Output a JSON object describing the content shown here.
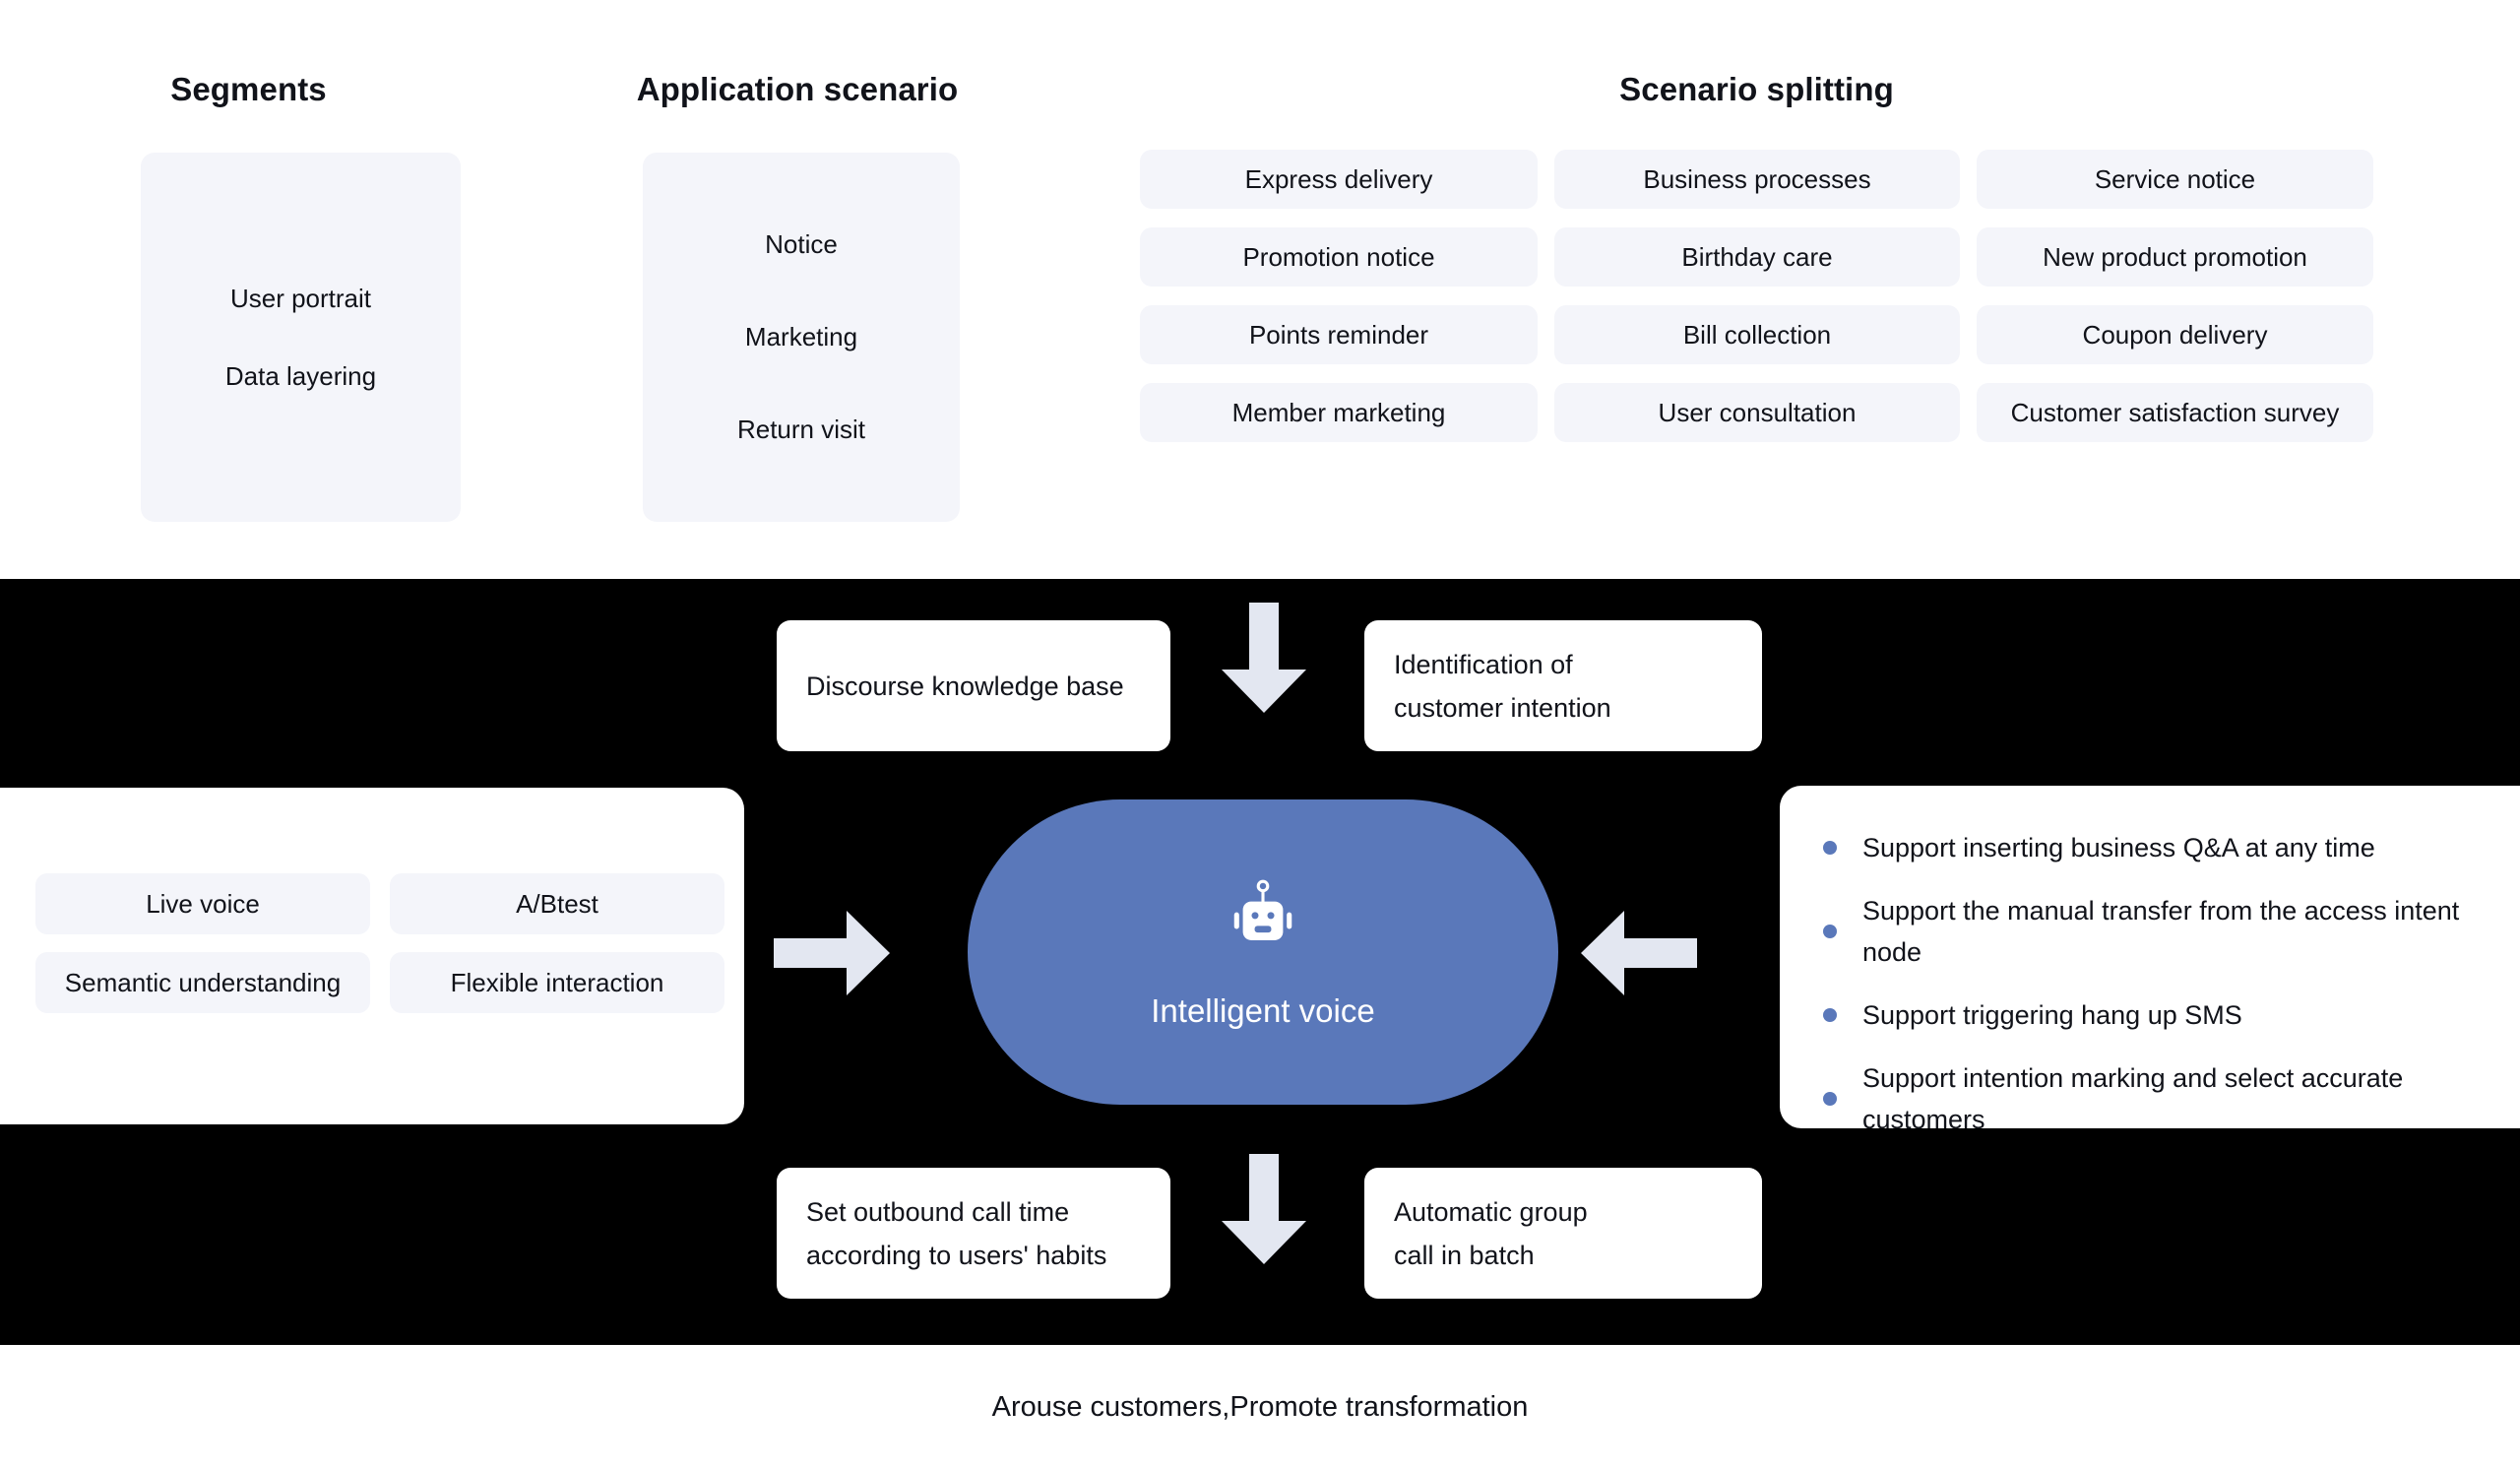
{
  "colors": {
    "chip_bg": "#f4f5fa",
    "accent_blue": "#5a78ba",
    "arrow_fill": "#e3e7f1",
    "black_panel": "#000000",
    "text": "#11131a"
  },
  "top": {
    "columns": [
      {
        "title": "Segments",
        "items": [
          "User portrait",
          "Data layering"
        ]
      },
      {
        "title": "Application scenario",
        "items": [
          "Notice",
          "Marketing",
          "Return visit"
        ]
      }
    ],
    "scenario_splitting": {
      "title": "Scenario splitting",
      "chips": [
        "Express delivery",
        "Business processes",
        "Service notice",
        "Promotion notice",
        "Birthday care",
        "New product promotion",
        "Points reminder",
        "Bill collection",
        "Coupon delivery",
        "Member marketing",
        "User consultation",
        "Customer satisfaction survey"
      ]
    }
  },
  "middle": {
    "center": {
      "label": "Intelligent voice",
      "icon": "robot-icon"
    },
    "top_cards": [
      {
        "text": "Discourse knowledge base"
      },
      {
        "text": "Identification of\ncustomer intention"
      }
    ],
    "bottom_cards": [
      {
        "text": "Set outbound call time\naccording to users' habits"
      },
      {
        "text": "Automatic group\ncall in batch"
      }
    ],
    "left_panel": {
      "chips": [
        "Live voice",
        "A/Btest",
        "Semantic understanding",
        "Flexible interaction"
      ]
    },
    "right_panel": {
      "bullets": [
        "Support inserting business Q&A at any time",
        "Support the manual transfer from the access intent node",
        "Support triggering hang up SMS",
        "Support intention marking and select accurate customers"
      ]
    },
    "arrows": [
      {
        "name": "arrow-down-top",
        "direction": "down"
      },
      {
        "name": "arrow-down-bottom",
        "direction": "down"
      },
      {
        "name": "arrow-right",
        "direction": "right"
      },
      {
        "name": "arrow-left",
        "direction": "left"
      }
    ]
  },
  "footer": {
    "text": "Arouse customers,Promote transformation"
  }
}
